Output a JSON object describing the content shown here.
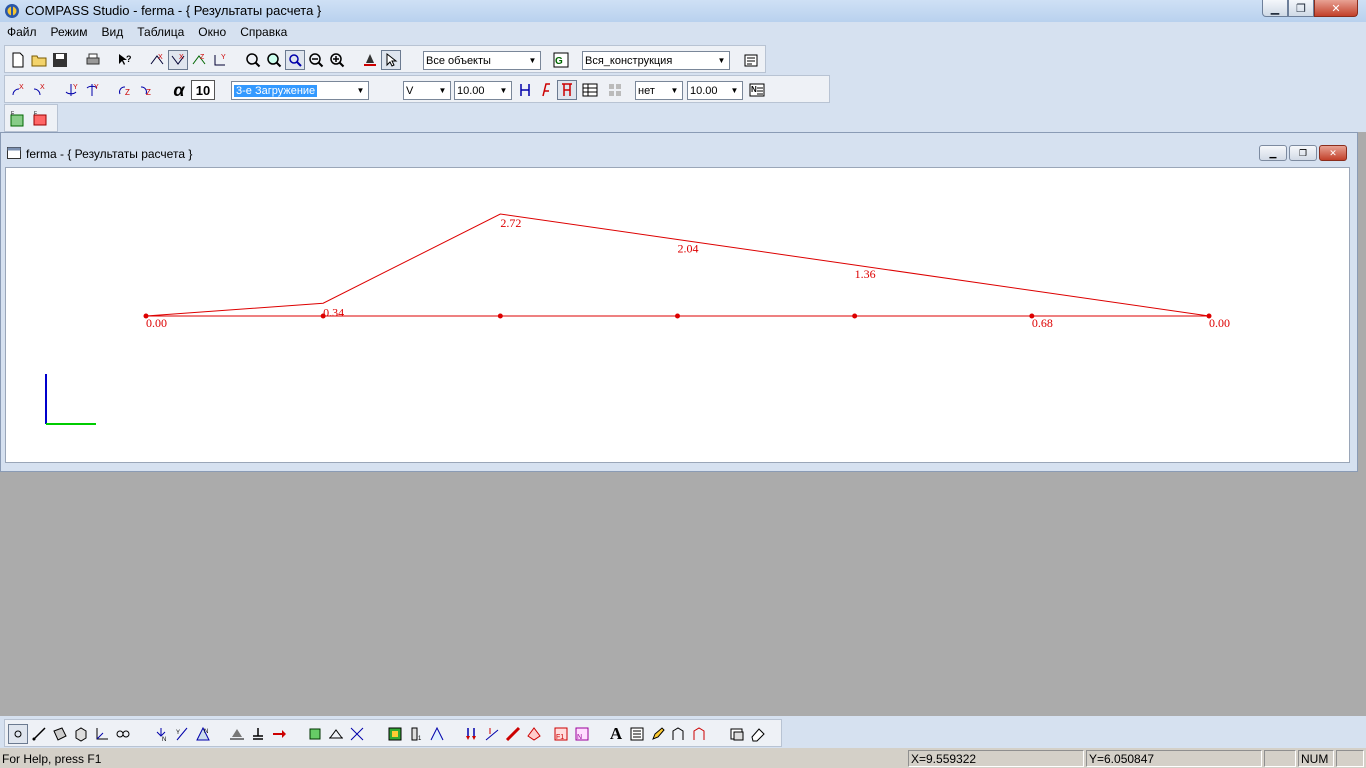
{
  "window": {
    "title": "COMPASS  Studio - ferma - { Результаты расчета }",
    "controls": [
      "minimize",
      "restore",
      "close"
    ]
  },
  "menu": [
    "Файл",
    "Режим",
    "Вид",
    "Таблица",
    "Окно",
    "Справка"
  ],
  "toolbar1": {
    "objects_combo": "Все объекты",
    "construction_combo": "Вся_конструкция"
  },
  "toolbar2": {
    "alpha_label": "α",
    "alpha_value": "10",
    "load_case_combo": "3-е Загружение",
    "force_combo": "V",
    "scale_combo": "10.00",
    "second_option_combo": "нет",
    "second_scale_combo": "10.00"
  },
  "document": {
    "title": "ferma - { Результаты расчета }"
  },
  "diagram": {
    "line_color": "#dd0000",
    "axis_y_color": "#0000cc",
    "axis_x_color": "#00cc00",
    "values": [
      {
        "label": "0.00",
        "value": 0.0
      },
      {
        "label": "0.34",
        "value": 0.34
      },
      {
        "label": "2.72",
        "value": 2.72
      },
      {
        "label": "2.04",
        "value": 2.04
      },
      {
        "label": "1.36",
        "value": 1.36
      },
      {
        "label": "0.68",
        "value": 0.68
      },
      {
        "label": "0.00",
        "value": 0.0
      }
    ]
  },
  "statusbar": {
    "help": "For Help, press F1",
    "x_coord": "X=9.559322",
    "y_coord": "Y=6.050847",
    "num": "NUM"
  }
}
